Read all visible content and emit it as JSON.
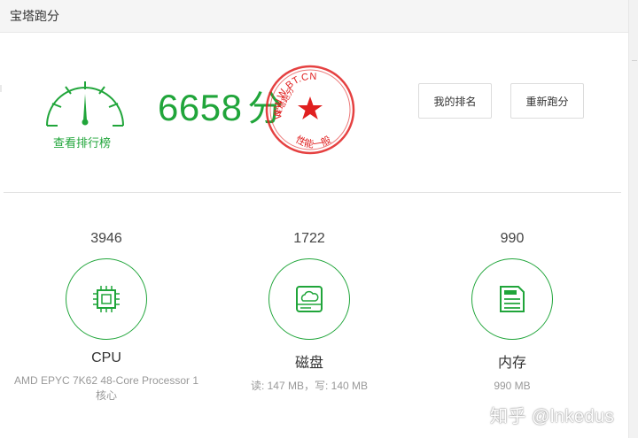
{
  "window": {
    "title": "宝塔跑分"
  },
  "overall": {
    "score": "6658",
    "unit": "分",
    "rank_link": "查看排行榜"
  },
  "stamp": {
    "url": "WWW.BT.CN",
    "side_text": "宝塔跑分",
    "grade": "性能一般"
  },
  "buttons": {
    "my_rank": "我的排名",
    "rerun": "重新跑分"
  },
  "metrics": [
    {
      "score": "3946",
      "name": "CPU",
      "detail": "AMD EPYC 7K62 48-Core Processor 1 核心",
      "icon": "cpu-chip-icon"
    },
    {
      "score": "1722",
      "name": "磁盘",
      "detail": "读: 147 MB，写: 140 MB",
      "icon": "disk-drive-icon"
    },
    {
      "score": "990",
      "name": "内存",
      "detail": "990 MB",
      "icon": "memory-card-icon"
    }
  ],
  "watermark": "知乎 @lnkedus",
  "colors": {
    "accent": "#20a53a",
    "stamp": "#e02020"
  }
}
